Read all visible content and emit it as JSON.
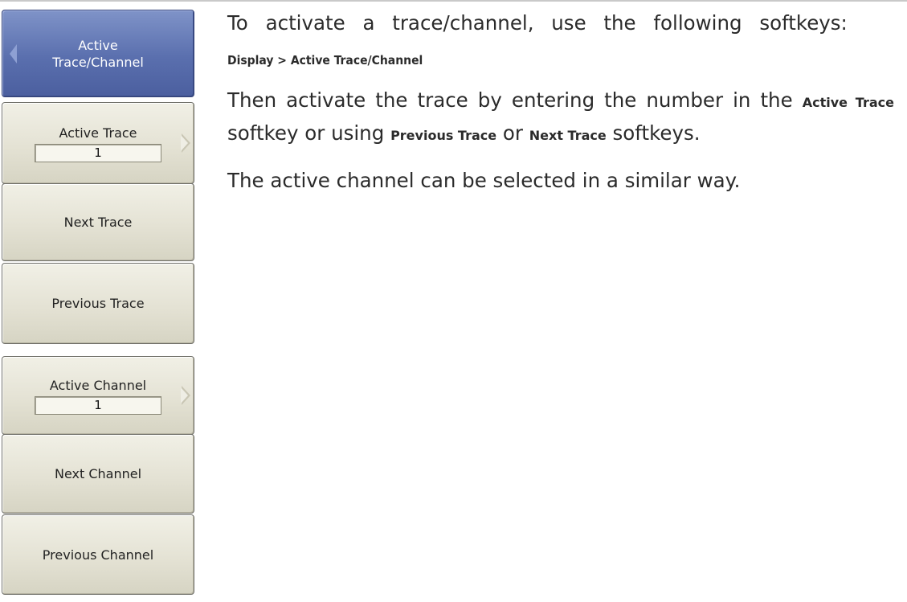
{
  "softkeys": {
    "header": {
      "line1": "Active",
      "line2": "Trace/Channel"
    },
    "active_trace": {
      "label": "Active Trace",
      "value": "1"
    },
    "next_trace": "Next Trace",
    "previous_trace": "Previous Trace",
    "active_channel": {
      "label": "Active Channel",
      "value": "1"
    },
    "next_channel": "Next Channel",
    "previous_channel": "Previous Channel"
  },
  "text": {
    "intro": "To activate a trace/channel, use the following softkeys:",
    "menu_path": "Display > Active Trace/Channel",
    "p2_a": "Then activate the trace by entering the number in the",
    "p2_k1": "Active Trace",
    "p2_b": "softkey or using",
    "p2_k2": "Previous Trace",
    "p2_c": "or",
    "p2_k3": "Next Trace",
    "p2_d": "softkeys.",
    "p3": "The active channel can be selected in a similar way."
  },
  "colors": {
    "header_key": "#5a6fae",
    "softkey_face": "#e4e2d4",
    "text": "#2b2b2b"
  }
}
